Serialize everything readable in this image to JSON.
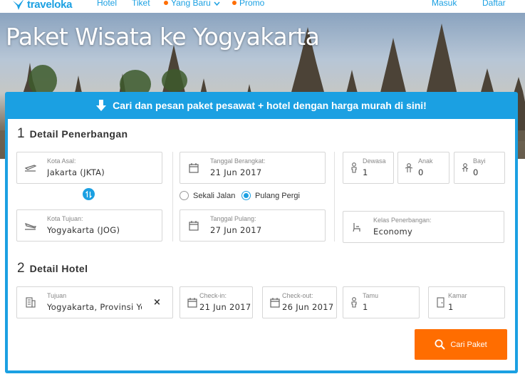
{
  "nav": {
    "brand": "traveloka",
    "links": [
      "Hotel",
      "Tiket",
      "Yang Baru",
      "Promo"
    ],
    "masuk": "Masuk",
    "daftar": "Daftar"
  },
  "hero": {
    "title": "Paket Wisata ke Yogyakarta"
  },
  "banner": {
    "text": "Cari dan pesan paket pesawat + hotel dengan harga murah di sini!"
  },
  "flight": {
    "number": "1",
    "title": "Detail Penerbangan",
    "origin": {
      "label": "Kota Asal:",
      "value": "Jakarta (JKTA)"
    },
    "destination": {
      "label": "Kota Tujuan:",
      "value": "Yogyakarta (JOG)"
    },
    "depart": {
      "label": "Tanggal Berangkat:",
      "value": "21 Jun 2017"
    },
    "return": {
      "label": "Tanggal Pulang:",
      "value": "27 Jun 2017"
    },
    "trip_options": [
      "Sekali Jalan",
      "Pulang Pergi"
    ],
    "trip_selected": "Pulang Pergi",
    "adults": {
      "label": "Dewasa",
      "value": "1"
    },
    "children": {
      "label": "Anak",
      "value": "0"
    },
    "infants": {
      "label": "Bayi",
      "value": "0"
    },
    "cabin": {
      "label": "Kelas Penerbangan:",
      "value": "Economy"
    }
  },
  "hotel": {
    "number": "2",
    "title": "Detail Hotel",
    "destination": {
      "label": "Tujuan",
      "value": "Yogyakarta, Provinsi Yogyakarta"
    },
    "checkin": {
      "label": "Check-in:",
      "value": "21 Jun 2017"
    },
    "checkout": {
      "label": "Check-out:",
      "value": "26 Jun 2017"
    },
    "guests": {
      "label": "Tamu",
      "value": "1"
    },
    "rooms": {
      "label": "Kamar",
      "value": "1"
    },
    "clear": "×"
  },
  "search": {
    "label": "Cari Paket"
  },
  "colors": {
    "brand": "#1ba0e2",
    "accent": "#ff6d00"
  },
  "icons": [
    "traveloka-logo-icon",
    "chevron-down-icon",
    "arrow-down-icon",
    "plane-takeoff-icon",
    "plane-landing-icon",
    "calendar-icon",
    "swap-icon",
    "person-icon",
    "child-icon",
    "baby-icon",
    "seat-icon",
    "building-icon",
    "door-icon",
    "search-icon"
  ]
}
